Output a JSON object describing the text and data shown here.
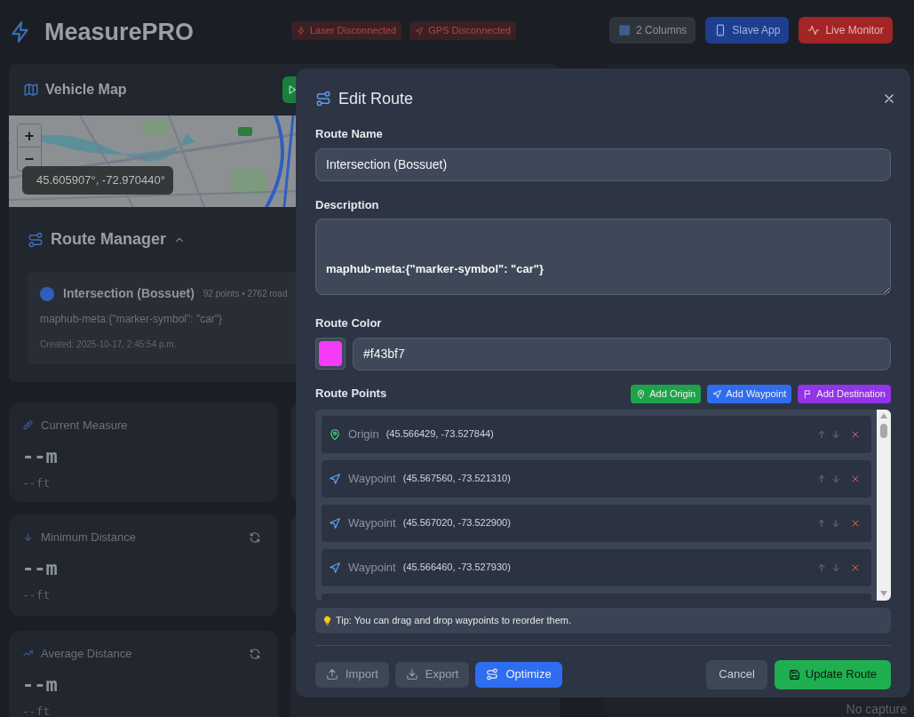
{
  "header": {
    "title": "MeasurePRO",
    "status_badges": [
      {
        "kind": "laser",
        "label": "Laser Disconnected"
      },
      {
        "kind": "gps",
        "label": "GPS Disconnected"
      }
    ],
    "buttons": [
      {
        "kind": "columns",
        "label": "2 Columns"
      },
      {
        "kind": "slave",
        "label": "Slave App"
      },
      {
        "kind": "monitor",
        "label": "Live Monitor"
      }
    ]
  },
  "vehicle_map": {
    "title": "Vehicle Map",
    "zoom_in": "+",
    "zoom_out": "−",
    "coordinates": "45.605907°, -72.970440°"
  },
  "route_manager": {
    "title": "Route Manager",
    "expanded": true,
    "routes": [
      {
        "name": "Intersection (Bossuet)",
        "color": "#2f5fb8",
        "stats": "92 points • 2762 road",
        "description": "maphub-meta:{\"marker-symbol\": \"car\"}",
        "created": "Created: 2025-10-17, 2:45:54 p.m."
      }
    ]
  },
  "stat_cards": [
    {
      "kind": "current",
      "title": "Current Measure",
      "value": "--m",
      "sub": "--ft",
      "refresh": false
    },
    {
      "kind": "minimum",
      "title": "Minimum Distance",
      "value": "--m",
      "sub": "--ft",
      "refresh": true
    },
    {
      "kind": "average",
      "title": "Average Distance",
      "value": "--m",
      "sub": "--ft",
      "refresh": true
    }
  ],
  "right_panel": {
    "empty_text": "No capture"
  },
  "edit_route": {
    "title": "Edit Route",
    "name_label": "Route Name",
    "name_value": "Intersection (Bossuet)",
    "description_label": "Description",
    "description_value": "maphub-meta:{\"marker-symbol\": \"car\"}",
    "color_label": "Route Color",
    "color_value": "#f43bf7",
    "points_label": "Route Points",
    "add_buttons": [
      {
        "kind": "origin",
        "label": "Add Origin"
      },
      {
        "kind": "waypoint",
        "label": "Add Waypoint"
      },
      {
        "kind": "destination",
        "label": "Add Destination"
      }
    ],
    "points": [
      {
        "kind": "origin",
        "label": "Origin",
        "coords": "(45.566429, -73.527844)"
      },
      {
        "kind": "waypoint",
        "label": "Waypoint",
        "coords": "(45.567560, -73.521310)"
      },
      {
        "kind": "waypoint",
        "label": "Waypoint",
        "coords": "(45.567020, -73.522900)"
      },
      {
        "kind": "waypoint",
        "label": "Waypoint",
        "coords": "(45.566460, -73.527930)"
      }
    ],
    "tip": "Tip: You can drag and drop waypoints to reorder them.",
    "footer_left": [
      {
        "kind": "import",
        "label": "Import"
      },
      {
        "kind": "export",
        "label": "Export"
      },
      {
        "kind": "optimize",
        "label": "Optimize"
      }
    ],
    "cancel": "Cancel",
    "submit": "Update Route"
  }
}
